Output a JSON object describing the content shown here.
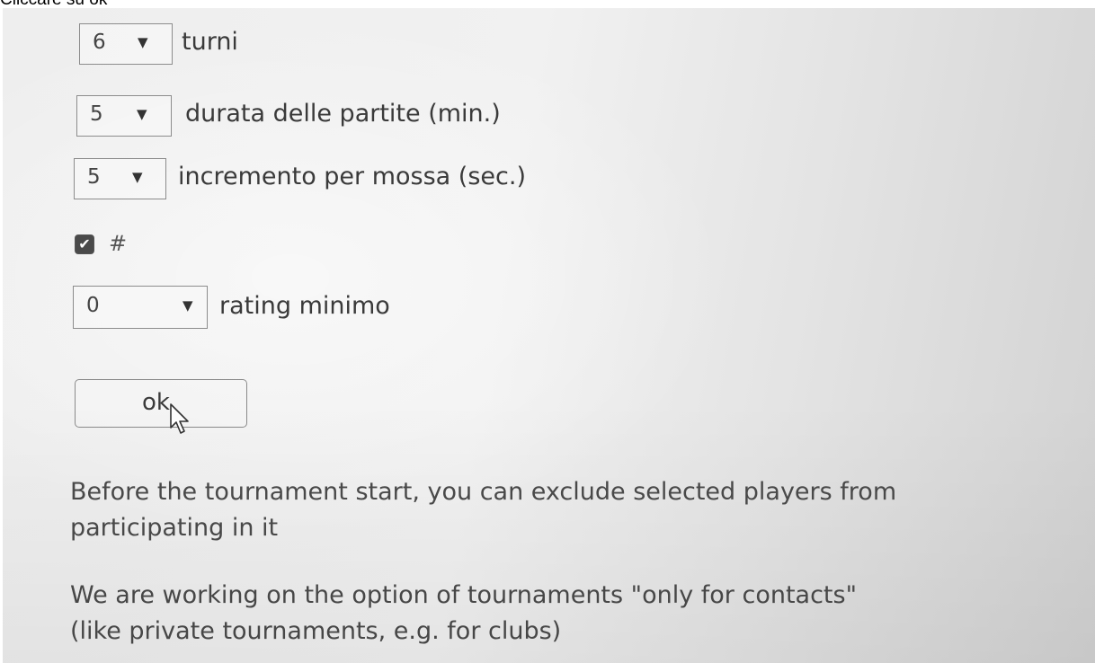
{
  "caption": "Cliccare su ok",
  "form": {
    "rounds": {
      "value": "6",
      "label": "turni"
    },
    "duration": {
      "value": "5",
      "label": "durata delle partite (min.)"
    },
    "increment": {
      "value": "5",
      "label": "incremento per mossa (sec.)"
    },
    "hash_option": {
      "checked": true,
      "label": "#"
    },
    "min_rating": {
      "value": "0",
      "label": "rating minimo"
    },
    "ok_label": "ok"
  },
  "notes": {
    "line1a": "Before the tournament start, you can exclude selected players from",
    "line1b": "participating in it",
    "line2a": "We are working on the option of tournaments \"only for contacts\"",
    "line2b": "(like private tournaments, e.g. for clubs)"
  },
  "icons": {
    "dropdown": "triangle-down-icon",
    "cursor": "pointer-cursor-icon",
    "check": "checkmark-icon"
  }
}
